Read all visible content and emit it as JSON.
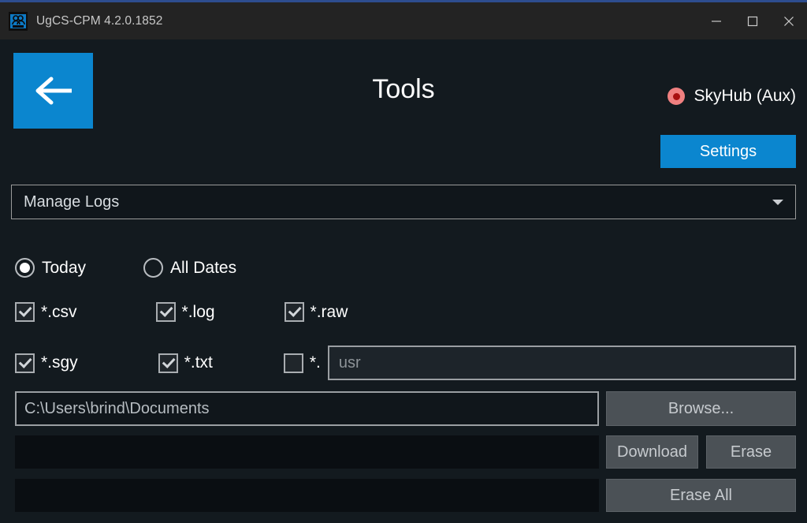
{
  "titlebar": {
    "app_icon": "people-industrial-icon",
    "title": "UgCS-CPM 4.2.0.1852",
    "minimize_label": "minimize-icon",
    "maximize_label": "maximize-icon",
    "close_label": "close-icon",
    "accent_color": "#2d4d8f"
  },
  "header": {
    "back_icon": "arrow-left-icon",
    "title": "Tools",
    "status": {
      "indicator": "red-dot-icon",
      "indicator_color": "#f08080",
      "label": "SkyHub (Aux)"
    },
    "settings_label": "Settings",
    "accent_color": "#0b86cf"
  },
  "mode_dropdown": {
    "value": "Manage Logs",
    "caret": "chevron-down-icon"
  },
  "date_filter": {
    "options": [
      {
        "label": "Today",
        "selected": true
      },
      {
        "label": "All Dates",
        "selected": false
      }
    ]
  },
  "file_types": {
    "row1": [
      {
        "label": "*.csv",
        "checked": true
      },
      {
        "label": "*.log",
        "checked": true
      },
      {
        "label": "*.raw",
        "checked": true
      }
    ],
    "row2": [
      {
        "label": "*.sgy",
        "checked": true
      },
      {
        "label": "*.txt",
        "checked": true
      }
    ],
    "custom": {
      "label": "*.",
      "checked": false,
      "value": "usr",
      "placeholder": "usr"
    }
  },
  "destination": {
    "path": "C:\\Users\\brind\\Documents",
    "path_placeholder": "C:\\Users\\brind\\Documents",
    "browse_label": "Browse..."
  },
  "actions": {
    "download_label": "Download",
    "erase_label": "Erase",
    "erase_all_label": "Erase All"
  },
  "progress": {
    "bar1_text": "",
    "bar2_text": ""
  }
}
